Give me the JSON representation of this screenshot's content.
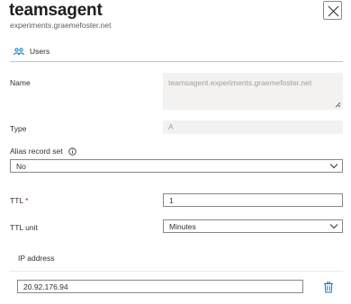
{
  "header": {
    "title": "teamsagent",
    "subtitle": "experiments.graemefoster.net",
    "close_icon": "close-icon"
  },
  "command_bar": {
    "users_label": "Users",
    "users_icon": "users-icon"
  },
  "form": {
    "name_label": "Name",
    "name_placeholder": "teamsagent.experiments.graemefoster.net",
    "type_label": "Type",
    "type_value": "A",
    "alias_label": "Alias record set",
    "alias_value": "No",
    "ttl_label": "TTL",
    "ttl_required": "*",
    "ttl_value": "1",
    "ttl_unit_label": "TTL unit",
    "ttl_unit_value": "Minutes",
    "ip_header": "IP address",
    "ip_value": "20.92.176.94"
  },
  "colors": {
    "accent": "#0078d4",
    "required": "#a4262c",
    "border": "#8a8886",
    "disabled_bg": "#f3f2f1"
  }
}
